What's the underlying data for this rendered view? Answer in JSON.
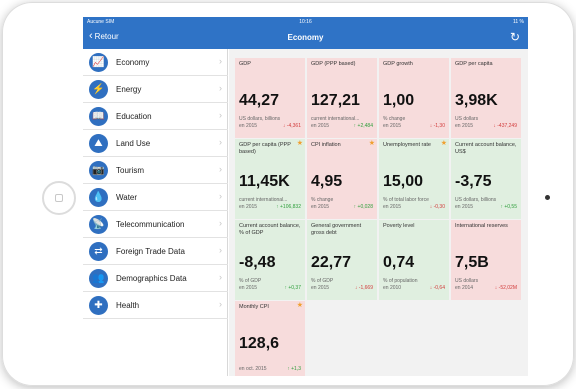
{
  "status_bar": {
    "carrier": "Aucune SIM",
    "time": "10:16",
    "battery": "11 %"
  },
  "nav": {
    "back_label": "Retour",
    "title": "Economy",
    "refresh_icon": "refresh-icon"
  },
  "sidebar": {
    "items": [
      {
        "label": "Economy",
        "icon": "chart-icon",
        "glyph": "📈"
      },
      {
        "label": "Energy",
        "icon": "lightning-icon",
        "glyph": "⚡"
      },
      {
        "label": "Education",
        "icon": "book-icon",
        "glyph": "📖"
      },
      {
        "label": "Land Use",
        "icon": "land-icon",
        "glyph": "⛰"
      },
      {
        "label": "Tourism",
        "icon": "camera-icon",
        "glyph": "📷"
      },
      {
        "label": "Water",
        "icon": "water-drop-icon",
        "glyph": "💧"
      },
      {
        "label": "Telecommunication",
        "icon": "satellite-dish-icon",
        "glyph": "📡"
      },
      {
        "label": "Foreign Trade Data",
        "icon": "trade-icon",
        "glyph": "⇄"
      },
      {
        "label": "Demographics Data",
        "icon": "people-icon",
        "glyph": "👥"
      },
      {
        "label": "Health",
        "icon": "health-icon",
        "glyph": "✚"
      }
    ]
  },
  "tiles": [
    {
      "name": "GDP",
      "value": "44,27",
      "unit": "US dollars, billions",
      "year": "en 2015",
      "delta": "↓ -4,361",
      "trend": "down",
      "color": "red",
      "star": false
    },
    {
      "name": "GDP (PPP based)",
      "value": "127,21",
      "unit": "current international...",
      "year": "en 2015",
      "delta": "↑ +2,484",
      "trend": "up",
      "color": "red",
      "star": false
    },
    {
      "name": "GDP growth",
      "value": "1,00",
      "unit": "% change",
      "year": "en 2015",
      "delta": "↓ -1,30",
      "trend": "down",
      "color": "red",
      "star": false
    },
    {
      "name": "GDP per capita",
      "value": "3,98K",
      "unit": "US dollars",
      "year": "en 2015",
      "delta": "↓ -437,249",
      "trend": "down",
      "color": "red",
      "star": false
    },
    {
      "name": "GDP per capita (PPP based)",
      "value": "11,45K",
      "unit": "current international...",
      "year": "en 2015",
      "delta": "↑ +106,832",
      "trend": "up",
      "color": "green",
      "star": true
    },
    {
      "name": "CPI inflation",
      "value": "4,95",
      "unit": "% change",
      "year": "en 2015",
      "delta": "↑ +0,028",
      "trend": "up",
      "color": "red",
      "star": true
    },
    {
      "name": "Unemployment rate",
      "value": "15,00",
      "unit": "% of total labor force",
      "year": "en 2015",
      "delta": "↓ -0,30",
      "trend": "down",
      "color": "green",
      "star": true
    },
    {
      "name": "Current account balance, US$",
      "value": "-3,75",
      "unit": "US dollars, billions",
      "year": "en 2015",
      "delta": "↑ +0,55",
      "trend": "up",
      "color": "green",
      "star": false
    },
    {
      "name": "Current account balance, % of GDP",
      "value": "-8,48",
      "unit": "% of GDP",
      "year": "en 2015",
      "delta": "↑ +0,37",
      "trend": "up",
      "color": "green",
      "star": false
    },
    {
      "name": "General government gross debt",
      "value": "22,77",
      "unit": "% of GDP",
      "year": "en 2015",
      "delta": "↓ -1,669",
      "trend": "down",
      "color": "green",
      "star": false
    },
    {
      "name": "Poverty level",
      "value": "0,74",
      "unit": "% of population",
      "year": "en 2010",
      "delta": "↓ -0,64",
      "trend": "down",
      "color": "green",
      "star": false
    },
    {
      "name": "International reserves",
      "value": "7,5B",
      "unit": "US dollars",
      "year": "en 2014",
      "delta": "↓ -52,02M",
      "trend": "down",
      "color": "red",
      "star": false
    },
    {
      "name": "Monthly CPI",
      "value": "128,6",
      "unit": "",
      "year": "en oct. 2015",
      "delta": "↑ +1,3",
      "trend": "up",
      "color": "red",
      "star": true
    }
  ],
  "colors": {
    "nav_blue": "#2f73c6",
    "tile_red": "#f7dcdc",
    "tile_green": "#e0efe0",
    "up": "#2e9e3b",
    "down": "#d23b3b",
    "star": "#f0a030"
  }
}
